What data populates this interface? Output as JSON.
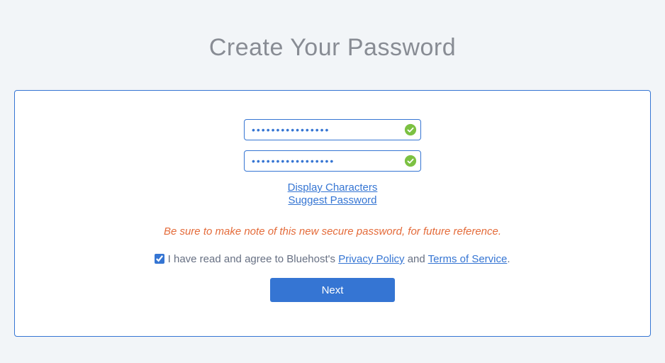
{
  "title": "Create Your Password",
  "form": {
    "password_value": "••••••••••••••••",
    "confirm_value": "•••••••••••••••••",
    "display_characters": "Display Characters",
    "suggest_password": "Suggest Password"
  },
  "note": "Be sure to make note of this new secure password, for future reference.",
  "agree": {
    "checked": true,
    "prefix": " I have read and agree to Bluehost's ",
    "privacy": "Privacy Policy",
    "mid": " and ",
    "terms": "Terms of Service",
    "suffix": "."
  },
  "next_label": "Next"
}
